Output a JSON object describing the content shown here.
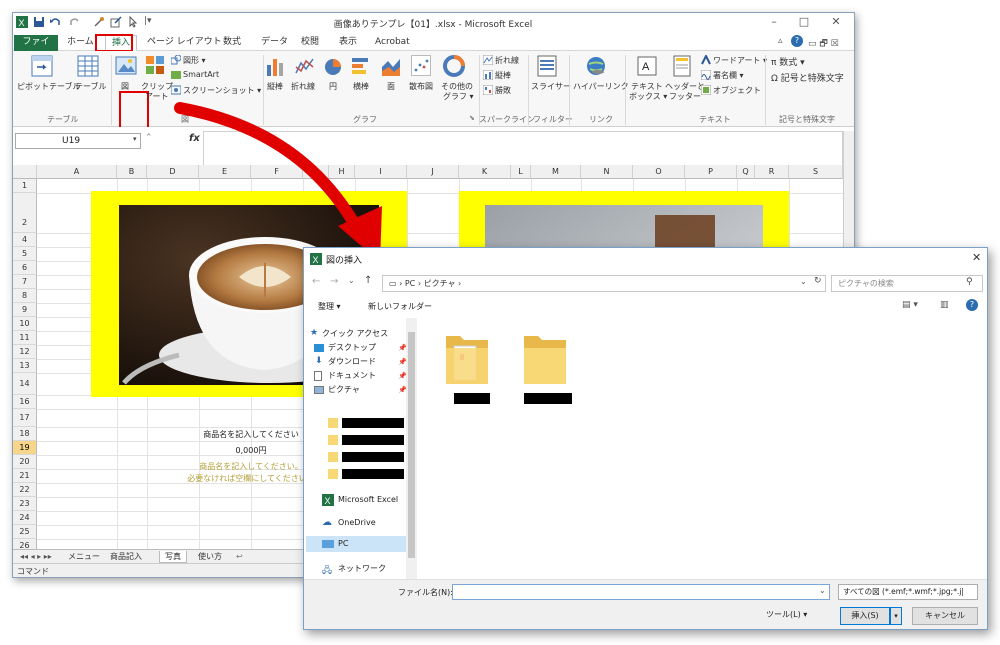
{
  "excel": {
    "title": "画像ありテンプレ【01】.xlsx - Microsoft Excel",
    "tabs": [
      "ファイル",
      "ホーム",
      "挿入",
      "ページ レイアウト",
      "数式",
      "データ",
      "校閲",
      "表示",
      "Acrobat"
    ],
    "active_tab": "挿入",
    "ribbon": {
      "pivot_table": "ピボットテーブル",
      "table": "テーブル",
      "picture": "図",
      "clip_art_1": "クリップ",
      "clip_art_2": "アート",
      "shapes": "図形 ▾",
      "smartart": "SmartArt",
      "screenshot": "スクリーンショット ▾",
      "bar": "縦棒",
      "line": "折れ線",
      "pie": "円",
      "hbar": "横棒",
      "area": "面",
      "scatter": "散布図",
      "other_1": "その他の",
      "other_2": "グラフ ▾",
      "spark_line": "折れ線",
      "spark_column": "縦棒",
      "spark_winloss": "勝敗",
      "slicer": "スライサー",
      "hyperlink": "ハイパーリンク",
      "textbox_1": "テキスト",
      "textbox_2": "ボックス ▾",
      "header_1": "ヘッダーと",
      "header_2": "フッター",
      "wordart": "ワードアート ▾",
      "signature": "署名欄 ▾",
      "object": "オブジェクト",
      "equation": "π 数式 ▾",
      "symbol": "Ω 記号と特殊文字",
      "groups": {
        "table": "テーブル",
        "figure": "図",
        "graph": "グラフ",
        "sparkline": "スパークライン",
        "filter": "フィルター",
        "link": "リンク",
        "text": "テキスト",
        "symbols": "記号と特殊文字"
      }
    },
    "name_box": "U19",
    "fx": "fx",
    "columns": [
      "A",
      "B",
      "D",
      "E",
      "F",
      "G",
      "H",
      "I",
      "J",
      "K",
      "L",
      "M",
      "N",
      "O",
      "P",
      "Q",
      "R",
      "S"
    ],
    "rows": [
      "1",
      "2",
      "4",
      "5",
      "6",
      "7",
      "8",
      "9",
      "10",
      "11",
      "12",
      "13",
      "14",
      "16",
      "17",
      "18",
      "19",
      "20",
      "21",
      "22",
      "23",
      "24",
      "25",
      "26"
    ],
    "selected_row": "19",
    "product_name": "商品名を記入してください",
    "price": "0,000円",
    "note_1": "商品名を記入してください。",
    "note_2": "必要なければ空欄にしてください。",
    "sheet_tabs": [
      "メニュー",
      "商品記入",
      "写真",
      "使い方"
    ],
    "status": "コマンド",
    "colors": {
      "accent": "#217346",
      "yellow": "#ffff00",
      "red": "#e00000"
    }
  },
  "dialog": {
    "title": "図の挿入",
    "address": [
      "PC",
      "ピクチャ"
    ],
    "search_placeholder": "ピクチャの検索",
    "organize": "整理 ▾",
    "new_folder": "新しいフォルダー",
    "nav": {
      "quick_access": "クイック アクセス",
      "desktop": "デスクトップ",
      "download": "ダウンロード",
      "documents": "ドキュメント",
      "pictures": "ピクチャ",
      "excel": "Microsoft Excel",
      "onedrive": "OneDrive",
      "pc": "PC",
      "network": "ネットワーク"
    },
    "filename_label": "ファイル名(N):",
    "filetype": "すべての図 (*.emf;*.wmf;*.jpg;*.j|",
    "tools": "ツール(L)  ▾",
    "insert": "挿入(S)",
    "cancel": "キャンセル"
  }
}
